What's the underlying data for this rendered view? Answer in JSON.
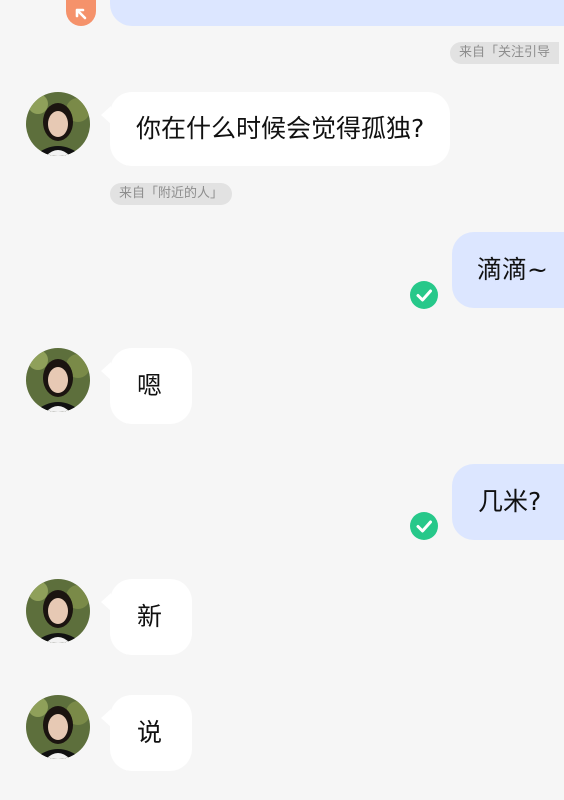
{
  "colors": {
    "background": "#f6f6f6",
    "incoming_bubble": "#ffffff",
    "outgoing_bubble": "#dce6ff",
    "sent_check": "#27c88a",
    "badge_orange": "#f5926b"
  },
  "source_tags": {
    "follow_guide": "来自「关注引导",
    "nearby": "来自「附近的人」"
  },
  "messages": {
    "question": "你在什么时候会觉得孤独?",
    "out_1": "滴滴~",
    "reply_1": "嗯",
    "out_2": "几米?",
    "reply_2": "新",
    "reply_3": "说"
  },
  "icons": {
    "badge": "arrow-up-left-icon",
    "sent": "check-circle-icon",
    "avatar": "user-avatar"
  }
}
